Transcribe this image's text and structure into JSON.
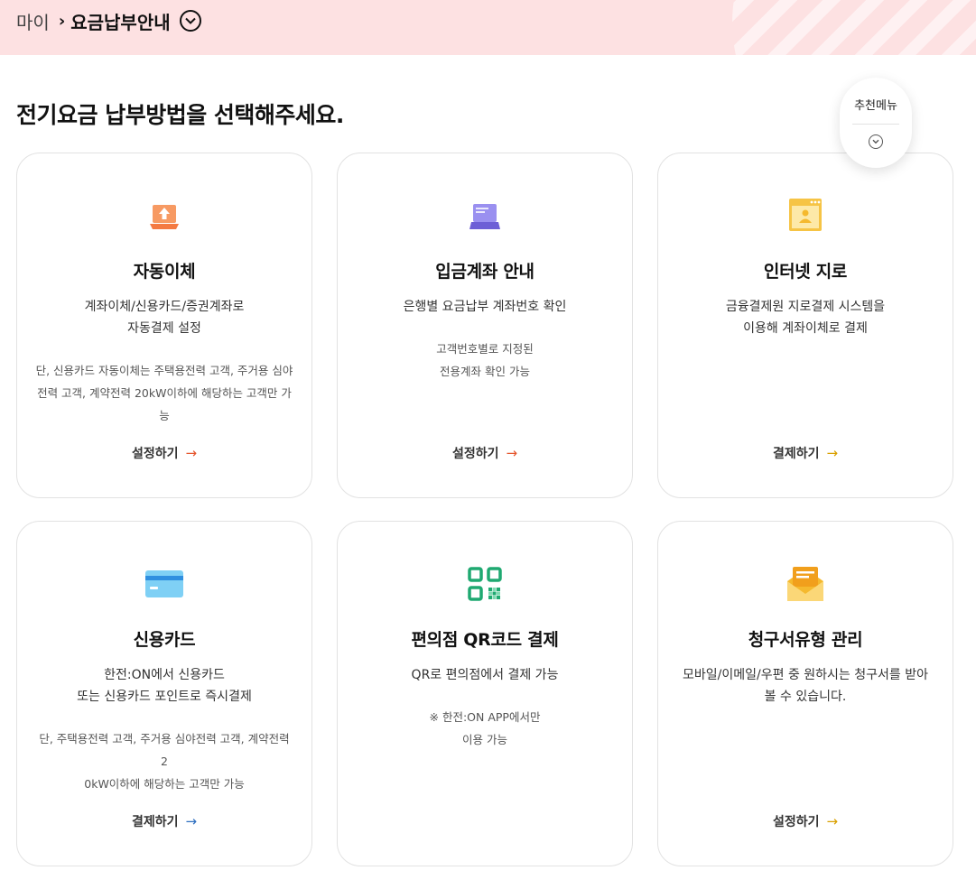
{
  "breadcrumb": {
    "home": "마이",
    "separator": "›",
    "current": "요금납부안내"
  },
  "heading": "전기요금 납부방법을 선택해주세요.",
  "recommend_menu": {
    "label": "추천메뉴"
  },
  "cards": [
    {
      "title": "자동이체",
      "desc1": "계좌이체/신용카드/증권계좌로",
      "desc2": "자동결제 설정",
      "note1": "단, 신용카드 자동이체는 주택용전력 고객, 주거용 심야",
      "note2": "전력 고객, 계약전력 20kW이하에 해당하는 고객만 가",
      "note3": "능",
      "action": "설정하기",
      "arrow": "→",
      "icon": "upload-laptop-icon",
      "color": "#f47a42"
    },
    {
      "title": "입금계좌 안내",
      "desc1": "은행별 요금납부 계좌번호 확인",
      "note1": "고객번호별로 지정된",
      "note2": "전용계좌 확인 가능",
      "action": "설정하기",
      "arrow": "→",
      "icon": "laptop-icon",
      "color": "#7b6fe0"
    },
    {
      "title": "인터넷 지로",
      "desc1": "금융결제원 지로결제 시스템을",
      "desc2": "이용해 계좌이체로 결제",
      "action": "결제하기",
      "arrow": "→",
      "icon": "web-document-icon",
      "color": "#f5b92e"
    },
    {
      "title": "신용카드",
      "desc1": "한전:ON에서 신용카드",
      "desc2": "또는 신용카드 포인트로 즉시결제",
      "note1": "단, 주택용전력 고객, 주거용 심야전력 고객, 계약전력 2",
      "note2": "0kW이하에 해당하는 고객만 가능",
      "action": "결제하기",
      "arrow": "→",
      "icon": "credit-card-icon",
      "color": "#3aa8e8"
    },
    {
      "title": "편의점 QR코드 결제",
      "desc1": "QR로 편의점에서 결제 가능",
      "note1": "※ 한전:ON APP에서만",
      "note2": "이용 가능",
      "icon": "qr-code-icon",
      "color": "#1fa971"
    },
    {
      "title": "청구서유형 관리",
      "desc1": "모바일/이메일/우편 중 원하시는 청구서를 받아",
      "desc2": "볼 수 있습니다.",
      "action": "설정하기",
      "arrow": "→",
      "icon": "mail-envelope-icon",
      "color": "#f5b92e"
    }
  ]
}
